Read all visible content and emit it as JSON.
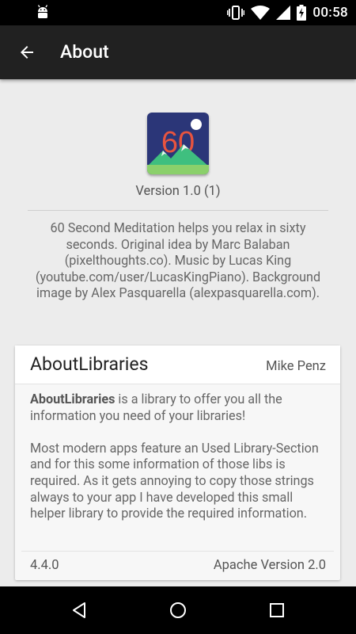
{
  "status_bar": {
    "time": "00:58",
    "icons": [
      "android-debug-icon",
      "vibrate-icon",
      "wifi-icon",
      "signal-icon",
      "battery-charging-icon"
    ]
  },
  "toolbar": {
    "title": "About",
    "back_icon": "arrow-back-icon"
  },
  "app": {
    "icon_text": "60",
    "version": "Version 1.0 (1)",
    "description": "60 Second Meditation helps you relax in sixty seconds. Original idea by Marc Balaban (pixelthoughts.co). Music by Lucas King (youtube.com/user/LucasKingPiano). Background image by Alex Pasquarella (alexpasquarella.com)."
  },
  "library": {
    "name": "AboutLibraries",
    "author": "Mike Penz",
    "desc_bold": "AboutLibraries",
    "desc_line1": " is a library to offer you all the information you need of your libraries!",
    "desc_para2": "Most modern apps feature an Used Library-Section and for this some information of those libs is required. As it gets annoying to copy those strings always to your app I have developed this small helper library to provide the required information.",
    "version": "4.4.0",
    "license": "Apache Version 2.0"
  },
  "nav_bar": {
    "icons": [
      "back-triangle-icon",
      "home-circle-icon",
      "recents-square-icon"
    ]
  },
  "colors": {
    "toolbar": "#212121",
    "background": "#ececec",
    "icon_bg": "#2b3678",
    "icon_number": "#e8543f",
    "mountain_green": "#3fbf7f"
  }
}
